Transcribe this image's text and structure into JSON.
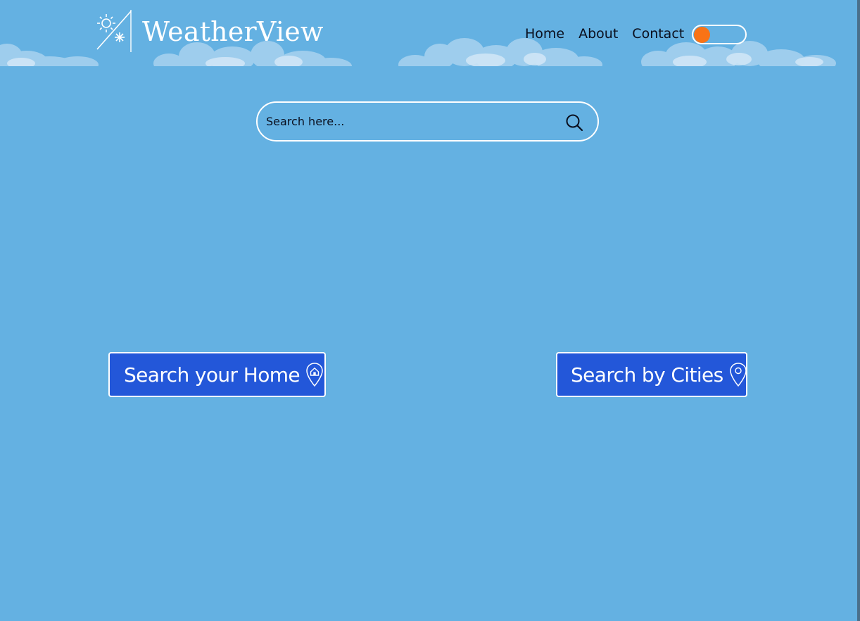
{
  "app": {
    "title": "WeatherView"
  },
  "nav": {
    "items": [
      "Home",
      "About",
      "Contact"
    ]
  },
  "theme_toggle": {
    "state": "off",
    "knob_color": "#f97316"
  },
  "search": {
    "placeholder": "Search here..."
  },
  "actions": {
    "home_label": "Search your Home",
    "cities_label": "Search by Cities"
  },
  "colors": {
    "background": "#64b1e2",
    "button": "#2357d9",
    "border": "#ffffff",
    "text_dark": "#0a0f1e"
  },
  "icons": {
    "logo": "sun-snow-icon",
    "search": "magnifier-icon",
    "home": "home-pin-icon",
    "cities": "location-pin-icon"
  }
}
